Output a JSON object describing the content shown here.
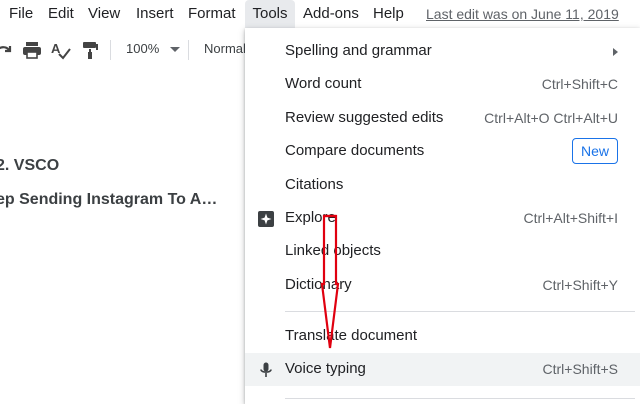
{
  "menubar": {
    "items": [
      {
        "label": "File"
      },
      {
        "label": "Edit"
      },
      {
        "label": "View"
      },
      {
        "label": "Insert"
      },
      {
        "label": "Format"
      },
      {
        "label": "Tools"
      },
      {
        "label": "Add-ons"
      },
      {
        "label": "Help"
      }
    ],
    "last_edit": "Last edit was on June 11, 2019"
  },
  "toolbar": {
    "zoom": "100%",
    "style": "Normal",
    "icons": [
      "redo-icon",
      "print-icon",
      "spellcheck-icon",
      "paint-format-icon",
      "dropdown-caret-icon"
    ]
  },
  "document": {
    "lines": [
      "2. VSCO",
      "ep Sending Instagram To A…"
    ]
  },
  "tools_menu": {
    "items": [
      {
        "label": "Spelling and grammar",
        "shortcut": "",
        "submenu": true
      },
      {
        "label": "Word count",
        "shortcut": "Ctrl+Shift+C"
      },
      {
        "label": "Review suggested edits",
        "shortcut": "Ctrl+Alt+O Ctrl+Alt+U"
      },
      {
        "label": "Compare documents",
        "shortcut": "",
        "badge": "New"
      },
      {
        "label": "Citations",
        "shortcut": ""
      },
      {
        "label": "Explore",
        "shortcut": "Ctrl+Alt+Shift+I",
        "icon": "explore-sparkle-icon"
      },
      {
        "label": "Linked objects",
        "shortcut": ""
      },
      {
        "label": "Dictionary",
        "shortcut": "Ctrl+Shift+Y"
      },
      {
        "label": "Translate document",
        "shortcut": ""
      },
      {
        "label": "Voice typing",
        "shortcut": "Ctrl+Shift+S",
        "icon": "microphone-icon",
        "hovered": true
      }
    ]
  },
  "colors": {
    "accent": "#1a73e8",
    "annotation_arrow": "#e0000f",
    "menu_active_bg": "#e8eaed",
    "hover_bg": "#f1f3f4"
  }
}
